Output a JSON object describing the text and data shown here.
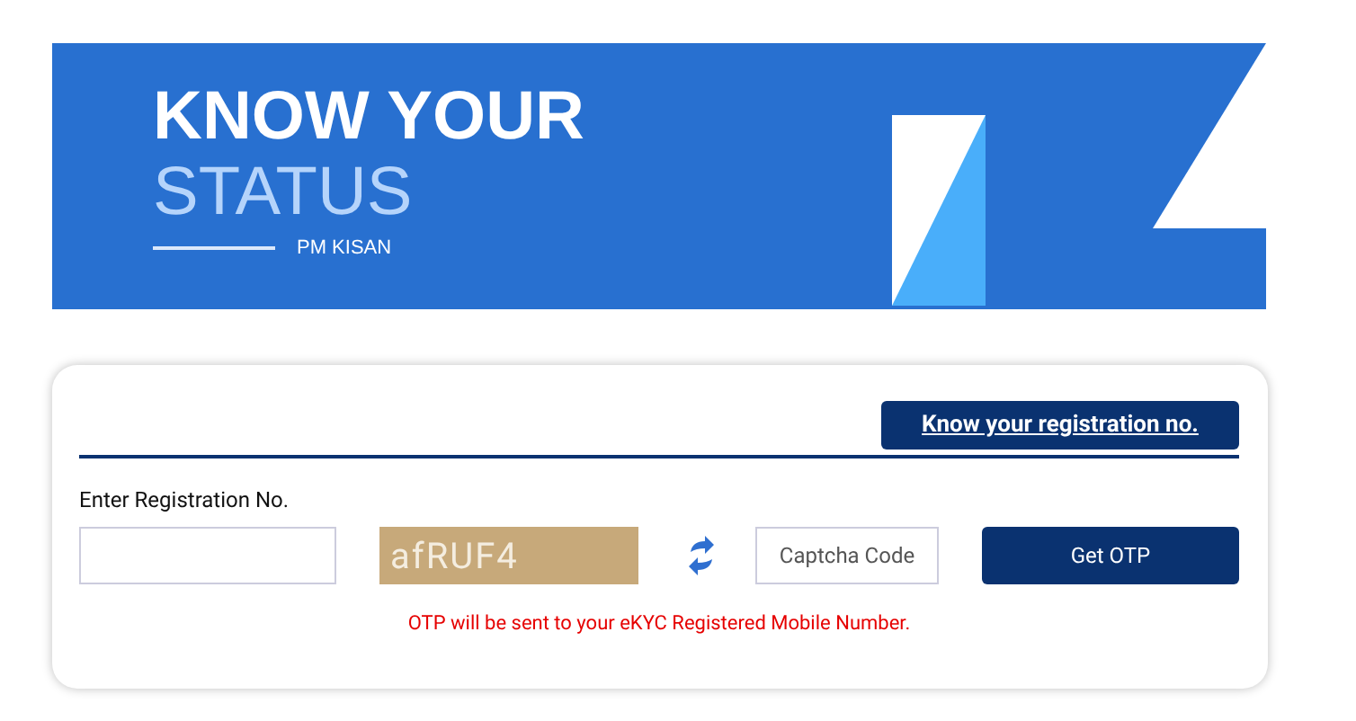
{
  "banner": {
    "title_line_1": "KNOW YOUR",
    "title_line_2": "STATUS",
    "subtitle": "PM KISAN"
  },
  "form": {
    "link_button": "Know your registration no.",
    "registration_label": "Enter Registration No.",
    "captcha_text": "afRUF4",
    "captcha_field": {
      "placeholder": "Captcha Code"
    },
    "submit_button": "Get OTP",
    "note": "OTP will be sent to your eKYC Registered Mobile Number."
  }
}
